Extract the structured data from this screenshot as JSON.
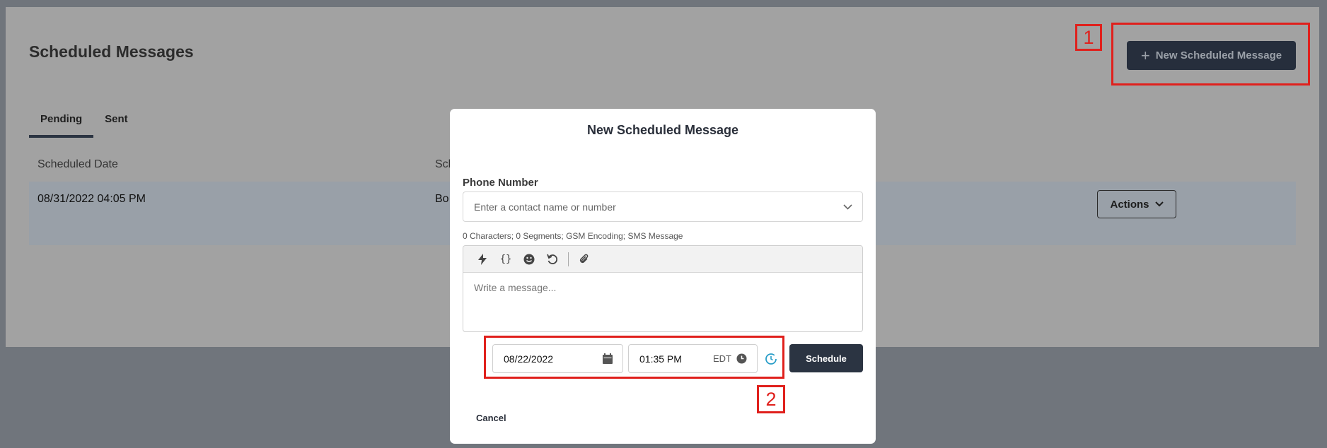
{
  "page": {
    "title": "Scheduled Messages",
    "new_button_label": "New Scheduled Message",
    "tabs": [
      {
        "label": "Pending",
        "active": true
      },
      {
        "label": "Sent",
        "active": false
      }
    ],
    "columns": [
      "Scheduled Date",
      "Sch"
    ],
    "rows": [
      {
        "scheduled_date": "08/31/2022 04:05 PM",
        "second_col": "Bo",
        "actions_label": "Actions"
      }
    ]
  },
  "modal": {
    "title": "New Scheduled Message",
    "phone_label": "Phone Number",
    "phone_placeholder": "Enter a contact name or number",
    "meta": "0 Characters; 0 Segments; GSM Encoding; SMS Message",
    "toolbar_icons": [
      "lightning-icon",
      "braces-icon",
      "emoji-icon",
      "undo-icon",
      "paperclip-icon"
    ],
    "message_placeholder": "Write a message...",
    "date_value": "08/22/2022",
    "time_value": "01:35 PM",
    "timezone": "EDT",
    "schedule_label": "Schedule",
    "cancel_label": "Cancel"
  },
  "annotations": [
    {
      "label": "1"
    },
    {
      "label": "2"
    }
  ],
  "colors": {
    "accent_dark": "#2b3442",
    "annotation_red": "#e0201c"
  }
}
